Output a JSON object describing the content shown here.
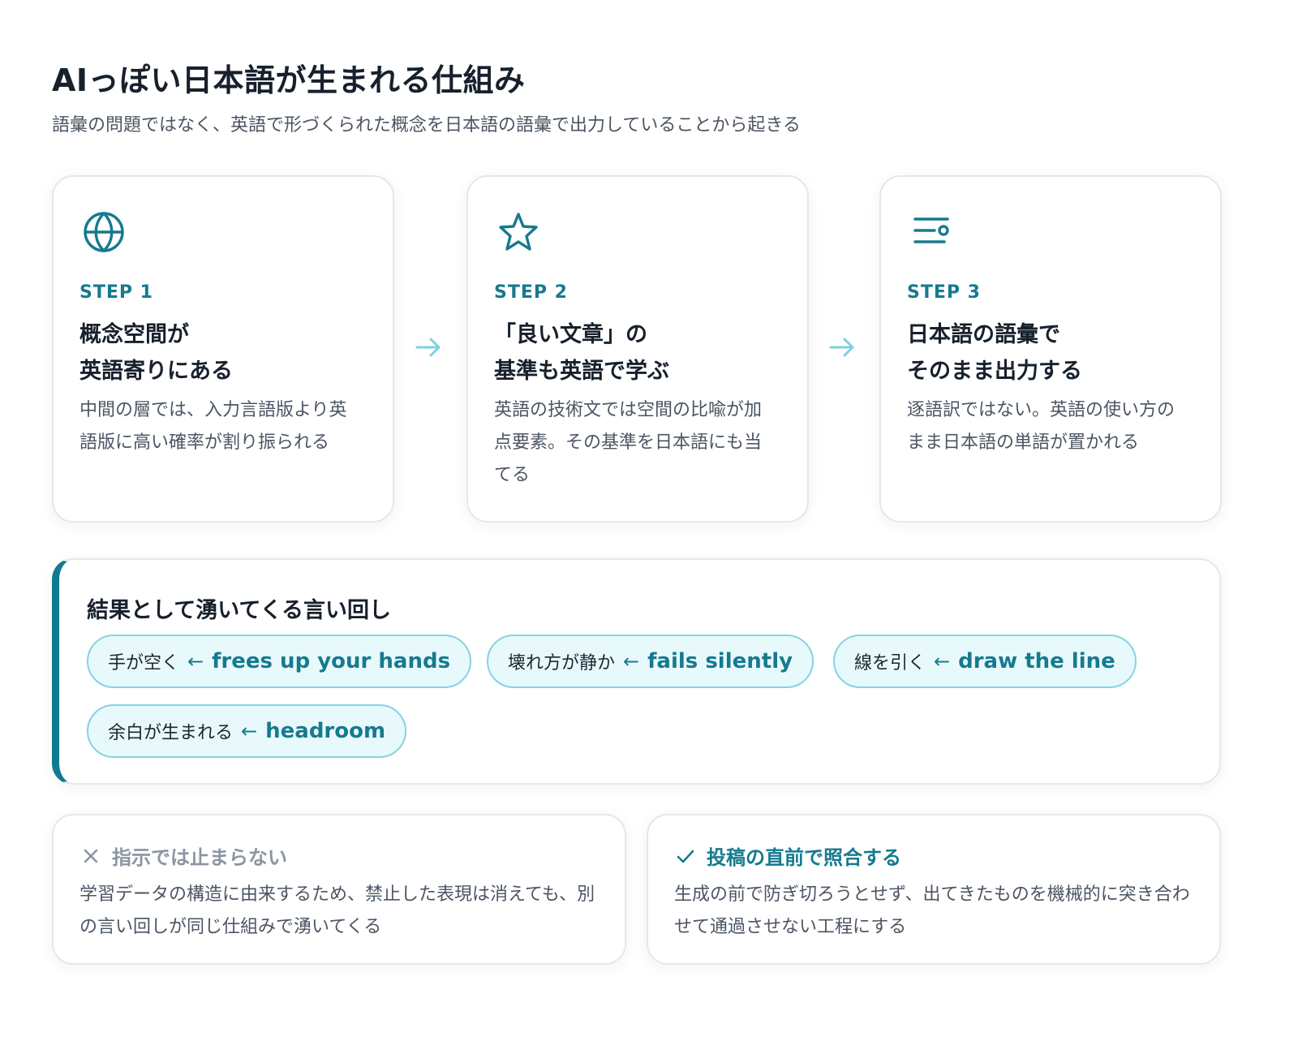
{
  "header": {
    "title": "AIっぽい日本語が生まれる仕組み",
    "subtitle": "語彙の問題ではなく、英語で形づくられた概念を日本語の語彙で出力していることから起きる"
  },
  "steps": [
    {
      "icon": "globe-icon",
      "label": "STEP 1",
      "title": "概念空間が\n英語寄りにある",
      "description": "中間の層では、入力言語版より英語版に高い確率が割り振られる"
    },
    {
      "icon": "star-icon",
      "label": "STEP 2",
      "title": "「良い文章」の\n基準も英語で学ぶ",
      "description": "英語の技術文では空間の比喩が加点要素。その基準を日本語にも当てる"
    },
    {
      "icon": "list-filter-icon",
      "label": "STEP 3",
      "title": "日本語の語彙で\nそのまま出力する",
      "description": "逐語訳ではない。英語の使い方のまま日本語の単語が置かれる"
    }
  ],
  "phrases": {
    "title": "結果として湧いてくる言い回し",
    "arrow": "←",
    "items": [
      {
        "jp": "手が空く",
        "en": "frees up your hands"
      },
      {
        "jp": "壊れ方が静か",
        "en": "fails silently"
      },
      {
        "jp": "線を引く",
        "en": "draw the line"
      },
      {
        "jp": "余白が生まれる",
        "en": "headroom"
      }
    ]
  },
  "notes": {
    "bad": {
      "icon": "x-icon",
      "heading": "指示では止まらない",
      "body": "学習データの構造に由来するため、禁止した表現は消えても、別の言い回しが同じ仕組みで湧いてくる"
    },
    "good": {
      "icon": "check-icon",
      "heading": "投稿の直前で照合する",
      "body": "生成の前で防ぎ切ろうとせず、出てきたものを機械的に突き合わせて通過させない工程にする"
    }
  },
  "colors": {
    "accent": "#167a8f",
    "chip_bg": "#e8f9fc",
    "chip_border": "#86d3e3",
    "flow_arrow": "#7fd0e0",
    "muted": "#8b95a3"
  }
}
